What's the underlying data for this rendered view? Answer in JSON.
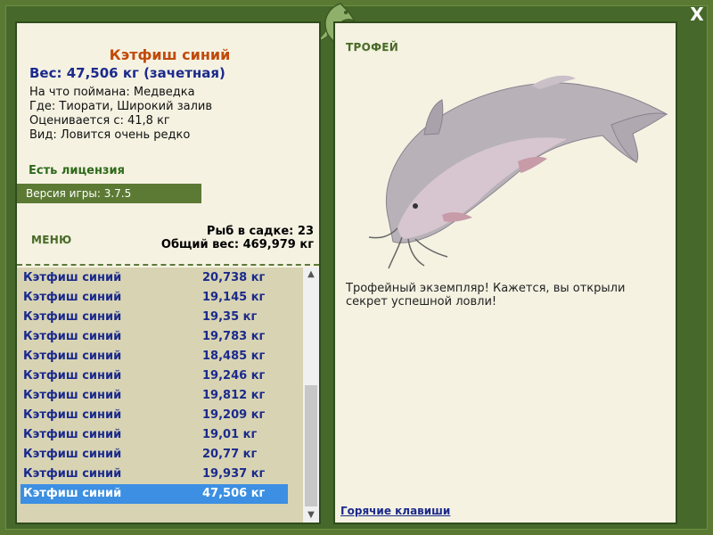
{
  "header": {
    "close_icon": "close-icon",
    "logo_icon": "dolphin-logo-icon"
  },
  "fish": {
    "title": "Кэтфиш синий",
    "weight_line": "Вес: 47,506 кг (зачетная)",
    "caught_on": "На что поймана: Медведка",
    "location": "Где: Тиорати, Широкий залив",
    "estimated": "Оценивается с: 41,8 кг",
    "species_note": "Вид: Ловится очень редко"
  },
  "license": "Есть лицензия",
  "version": "Версия игры: 3.7.5",
  "menu_label": "МЕНЮ",
  "stats": {
    "in_cage": "Рыб в садке: 23",
    "total_weight": "Общий вес: 469,979 кг"
  },
  "catch_list": [
    {
      "name": "Кэтфиш синий",
      "weight": "20,738 кг"
    },
    {
      "name": "Кэтфиш синий",
      "weight": "19,145 кг"
    },
    {
      "name": "Кэтфиш синий",
      "weight": "19,35 кг"
    },
    {
      "name": "Кэтфиш синий",
      "weight": "19,783 кг"
    },
    {
      "name": "Кэтфиш синий",
      "weight": "18,485 кг"
    },
    {
      "name": "Кэтфиш синий",
      "weight": "19,246 кг"
    },
    {
      "name": "Кэтфиш синий",
      "weight": "19,812 кг"
    },
    {
      "name": "Кэтфиш синий",
      "weight": "19,209 кг"
    },
    {
      "name": "Кэтфиш синий",
      "weight": "19,01 кг"
    },
    {
      "name": "Кэтфиш синий",
      "weight": "20,77 кг"
    },
    {
      "name": "Кэтфиш синий",
      "weight": "19,937 кг"
    },
    {
      "name": "Кэтфиш синий",
      "weight": "47,506 кг"
    }
  ],
  "selected_index": 11,
  "trophy": {
    "label": "ТРОФЕЙ",
    "text": "Трофейный экземпляр! Кажется, вы открыли секрет успешной ловли!",
    "image_icon": "catfish-image"
  },
  "hotkeys_link": "Горячие клавиши",
  "colors": {
    "frame": "#5a7a34",
    "panel": "#f5f2e2",
    "selected": "#3c8fe2",
    "title": "#c24a0a",
    "list_text": "#1b2a8c"
  }
}
